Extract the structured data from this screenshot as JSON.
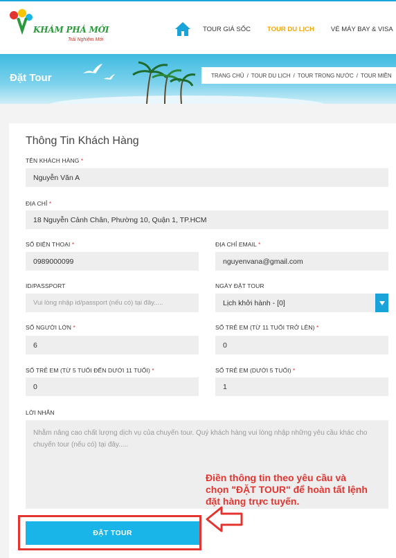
{
  "brand": {
    "name": "KHÁM PHÁ MỚI",
    "tagline": "Trải Nghiệm Mới"
  },
  "nav": {
    "items": [
      {
        "label": "TOUR GIÁ SỐC",
        "active": false
      },
      {
        "label": "TOUR DU LỊCH",
        "active": true
      },
      {
        "label": "VÉ MÁY BAY & VISA",
        "active": false
      }
    ],
    "icon": "home-icon"
  },
  "banner": {
    "title": "Đặt Tour",
    "breadcrumb": [
      "TRANG CHỦ",
      "/",
      "TOUR DU LỊCH",
      "/",
      "TOUR TRONG NƯỚC",
      "/",
      "TOUR MIỀN"
    ]
  },
  "form": {
    "title": "Thông Tin Khách Hàng",
    "name": {
      "label": "TÊN KHÁCH HÀNG",
      "value": "Nguyễn Văn A"
    },
    "address": {
      "label": "ĐỊA CHỈ",
      "value": "18 Nguyễn Cảnh Chân, Phường 10, Quận 1, TP.HCM"
    },
    "phone": {
      "label": "SỐ ĐIỆN THOẠI",
      "value": "0989000099"
    },
    "email": {
      "label": "ĐỊA CHỈ EMAIL",
      "value": "nguyenvana@gmail.com"
    },
    "passport": {
      "label": "ID/PASSPORT",
      "placeholder": "Vui lòng nhập id/passport (nếu có) tại đây....."
    },
    "date": {
      "label": "NGÀY ĐẶT TOUR",
      "value": "Lịch khởi hành - [0]"
    },
    "adults": {
      "label": "SỐ NGƯỜI LỚN",
      "value": "6"
    },
    "children11": {
      "label": "SỐ TRẺ EM (TỪ 11 TUỔI TRỞ LÊN)",
      "value": "0"
    },
    "children5": {
      "label": "SỐ TRẺ EM (TỪ 5 TUỔI ĐẾN DƯỚI 11 TUỔI)",
      "value": "0"
    },
    "infants": {
      "label": "SỐ TRẺ EM (DƯỚI 5 TUỔI)",
      "value": "1"
    },
    "message": {
      "label": "LỜI NHẮN",
      "placeholder": "Nhằm nâng cao chất lượng dịch vụ của chuyến tour. Quý khách hàng vui lòng nhập những yêu cầu khác cho chuyến tour (nếu có) tại đây....."
    },
    "required_mark": "*",
    "submit_label": "ĐẶT TOUR"
  },
  "annotation": {
    "text": "Điền thông tin theo yêu cầu và chọn \"ĐẶT TOUR\" để hoàn tất lệnh đặt hàng trực tuyến."
  },
  "colors": {
    "accent": "#19b4e8",
    "active_nav": "#f7a600",
    "required": "#e3342f",
    "highlight": "#e3342f"
  }
}
